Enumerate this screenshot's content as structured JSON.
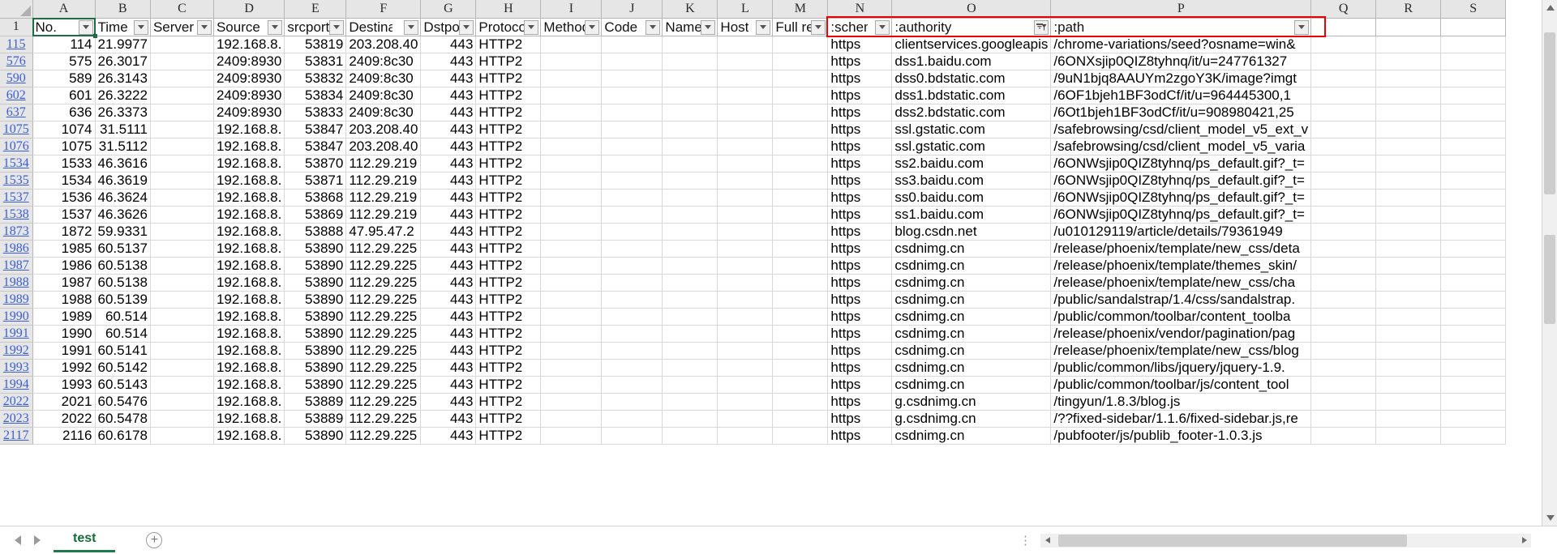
{
  "app": {
    "type": "spreadsheet",
    "sheet_tab": "test",
    "add_sheet_label": "+",
    "selected_cell": "A1",
    "accent_green": "#1f6b43",
    "annotation_color": "#ee0000",
    "row_header_color": "#3b5ed7"
  },
  "columns": {
    "letters": [
      "A",
      "B",
      "C",
      "D",
      "E",
      "F",
      "G",
      "H",
      "I",
      "J",
      "K",
      "L",
      "M",
      "N",
      "O",
      "P",
      "Q",
      "R",
      "S"
    ],
    "headers": [
      {
        "letter": "A",
        "label": "No.",
        "filter": "dropdown"
      },
      {
        "letter": "B",
        "label": "Time",
        "filter": "dropdown"
      },
      {
        "letter": "C",
        "label": "Server N",
        "filter": "dropdown"
      },
      {
        "letter": "D",
        "label": "Source",
        "filter": "dropdown"
      },
      {
        "letter": "E",
        "label": "srcport",
        "filter": "dropdown"
      },
      {
        "letter": "F",
        "label": "Destinat",
        "filter": "dropdown"
      },
      {
        "letter": "G",
        "label": "Dstport",
        "filter": "dropdown"
      },
      {
        "letter": "H",
        "label": "Protoco",
        "filter": "dropdown"
      },
      {
        "letter": "I",
        "label": "Method",
        "filter": "dropdown"
      },
      {
        "letter": "J",
        "label": "Code",
        "filter": "dropdown"
      },
      {
        "letter": "K",
        "label": "Name",
        "filter": "dropdown"
      },
      {
        "letter": "L",
        "label": "Host",
        "filter": "dropdown"
      },
      {
        "letter": "M",
        "label": "Full req",
        "filter": "dropdown"
      },
      {
        "letter": "N",
        "label": ":scheme",
        "filter": "dropdown"
      },
      {
        "letter": "O",
        "label": ":authority",
        "filter": "funnel"
      },
      {
        "letter": "P",
        "label": ":path",
        "filter": "dropdown"
      },
      {
        "letter": "Q",
        "label": "",
        "filter": "none"
      },
      {
        "letter": "R",
        "label": "",
        "filter": "none"
      },
      {
        "letter": "S",
        "label": "",
        "filter": "none"
      }
    ],
    "header_row_number": "1"
  },
  "rows": [
    {
      "rownum": "115",
      "no": "114",
      "time": "21.9977",
      "server": "",
      "source": "192.168.8.",
      "srcport": "53819",
      "destination": "203.208.40",
      "dstport": "443",
      "protocol": "HTTP2",
      "method": "",
      "code": "",
      "name": "",
      "host": "",
      "fullreq": "",
      "scheme": "https",
      "authority": "clientservices.googleapis",
      "path": "/chrome-variations/seed?osname=win&"
    },
    {
      "rownum": "576",
      "no": "575",
      "time": "26.3017",
      "server": "",
      "source": "2409:8930",
      "srcport": "53831",
      "destination": "2409:8c30",
      "dstport": "443",
      "protocol": "HTTP2",
      "method": "",
      "code": "",
      "name": "",
      "host": "",
      "fullreq": "",
      "scheme": "https",
      "authority": "dss1.baidu.com",
      "path": "/6ONXsjip0QIZ8tyhnq/it/u=247761327"
    },
    {
      "rownum": "590",
      "no": "589",
      "time": "26.3143",
      "server": "",
      "source": "2409:8930",
      "srcport": "53832",
      "destination": "2409:8c30",
      "dstport": "443",
      "protocol": "HTTP2",
      "method": "",
      "code": "",
      "name": "",
      "host": "",
      "fullreq": "",
      "scheme": "https",
      "authority": "dss0.bdstatic.com",
      "path": "/9uN1bjq8AAUYm2zgoY3K/image?imgt"
    },
    {
      "rownum": "602",
      "no": "601",
      "time": "26.3222",
      "server": "",
      "source": "2409:8930",
      "srcport": "53834",
      "destination": "2409:8c30",
      "dstport": "443",
      "protocol": "HTTP2",
      "method": "",
      "code": "",
      "name": "",
      "host": "",
      "fullreq": "",
      "scheme": "https",
      "authority": "dss1.bdstatic.com",
      "path": "/6OF1bjeh1BF3odCf/it/u=964445300,1"
    },
    {
      "rownum": "637",
      "no": "636",
      "time": "26.3373",
      "server": "",
      "source": "2409:8930",
      "srcport": "53833",
      "destination": "2409:8c30",
      "dstport": "443",
      "protocol": "HTTP2",
      "method": "",
      "code": "",
      "name": "",
      "host": "",
      "fullreq": "",
      "scheme": "https",
      "authority": "dss2.bdstatic.com",
      "path": "/6Ot1bjeh1BF3odCf/it/u=908980421,25"
    },
    {
      "rownum": "1075",
      "no": "1074",
      "time": "31.5111",
      "server": "",
      "source": "192.168.8.",
      "srcport": "53847",
      "destination": "203.208.40",
      "dstport": "443",
      "protocol": "HTTP2",
      "method": "",
      "code": "",
      "name": "",
      "host": "",
      "fullreq": "",
      "scheme": "https",
      "authority": "ssl.gstatic.com",
      "path": "/safebrowsing/csd/client_model_v5_ext_v"
    },
    {
      "rownum": "1076",
      "no": "1075",
      "time": "31.5112",
      "server": "",
      "source": "192.168.8.",
      "srcport": "53847",
      "destination": "203.208.40",
      "dstport": "443",
      "protocol": "HTTP2",
      "method": "",
      "code": "",
      "name": "",
      "host": "",
      "fullreq": "",
      "scheme": "https",
      "authority": "ssl.gstatic.com",
      "path": "/safebrowsing/csd/client_model_v5_varia"
    },
    {
      "rownum": "1534",
      "no": "1533",
      "time": "46.3616",
      "server": "",
      "source": "192.168.8.",
      "srcport": "53870",
      "destination": "112.29.219",
      "dstport": "443",
      "protocol": "HTTP2",
      "method": "",
      "code": "",
      "name": "",
      "host": "",
      "fullreq": "",
      "scheme": "https",
      "authority": "ss2.baidu.com",
      "path": "/6ONWsjip0QIZ8tyhnq/ps_default.gif?_t="
    },
    {
      "rownum": "1535",
      "no": "1534",
      "time": "46.3619",
      "server": "",
      "source": "192.168.8.",
      "srcport": "53871",
      "destination": "112.29.219",
      "dstport": "443",
      "protocol": "HTTP2",
      "method": "",
      "code": "",
      "name": "",
      "host": "",
      "fullreq": "",
      "scheme": "https",
      "authority": "ss3.baidu.com",
      "path": "/6ONWsjip0QIZ8tyhnq/ps_default.gif?_t="
    },
    {
      "rownum": "1537",
      "no": "1536",
      "time": "46.3624",
      "server": "",
      "source": "192.168.8.",
      "srcport": "53868",
      "destination": "112.29.219",
      "dstport": "443",
      "protocol": "HTTP2",
      "method": "",
      "code": "",
      "name": "",
      "host": "",
      "fullreq": "",
      "scheme": "https",
      "authority": "ss0.baidu.com",
      "path": "/6ONWsjip0QIZ8tyhnq/ps_default.gif?_t="
    },
    {
      "rownum": "1538",
      "no": "1537",
      "time": "46.3626",
      "server": "",
      "source": "192.168.8.",
      "srcport": "53869",
      "destination": "112.29.219",
      "dstport": "443",
      "protocol": "HTTP2",
      "method": "",
      "code": "",
      "name": "",
      "host": "",
      "fullreq": "",
      "scheme": "https",
      "authority": "ss1.baidu.com",
      "path": "/6ONWsjip0QIZ8tyhnq/ps_default.gif?_t="
    },
    {
      "rownum": "1873",
      "no": "1872",
      "time": "59.9331",
      "server": "",
      "source": "192.168.8.",
      "srcport": "53888",
      "destination": "47.95.47.2",
      "dstport": "443",
      "protocol": "HTTP2",
      "method": "",
      "code": "",
      "name": "",
      "host": "",
      "fullreq": "",
      "scheme": "https",
      "authority": "blog.csdn.net",
      "path": "/u010129119/article/details/79361949"
    },
    {
      "rownum": "1986",
      "no": "1985",
      "time": "60.5137",
      "server": "",
      "source": "192.168.8.",
      "srcport": "53890",
      "destination": "112.29.225",
      "dstport": "443",
      "protocol": "HTTP2",
      "method": "",
      "code": "",
      "name": "",
      "host": "",
      "fullreq": "",
      "scheme": "https",
      "authority": "csdnimg.cn",
      "path": "/release/phoenix/template/new_css/deta"
    },
    {
      "rownum": "1987",
      "no": "1986",
      "time": "60.5138",
      "server": "",
      "source": "192.168.8.",
      "srcport": "53890",
      "destination": "112.29.225",
      "dstport": "443",
      "protocol": "HTTP2",
      "method": "",
      "code": "",
      "name": "",
      "host": "",
      "fullreq": "",
      "scheme": "https",
      "authority": "csdnimg.cn",
      "path": "/release/phoenix/template/themes_skin/"
    },
    {
      "rownum": "1988",
      "no": "1987",
      "time": "60.5138",
      "server": "",
      "source": "192.168.8.",
      "srcport": "53890",
      "destination": "112.29.225",
      "dstport": "443",
      "protocol": "HTTP2",
      "method": "",
      "code": "",
      "name": "",
      "host": "",
      "fullreq": "",
      "scheme": "https",
      "authority": "csdnimg.cn",
      "path": "/release/phoenix/template/new_css/cha"
    },
    {
      "rownum": "1989",
      "no": "1988",
      "time": "60.5139",
      "server": "",
      "source": "192.168.8.",
      "srcport": "53890",
      "destination": "112.29.225",
      "dstport": "443",
      "protocol": "HTTP2",
      "method": "",
      "code": "",
      "name": "",
      "host": "",
      "fullreq": "",
      "scheme": "https",
      "authority": "csdnimg.cn",
      "path": "/public/sandalstrap/1.4/css/sandalstrap."
    },
    {
      "rownum": "1990",
      "no": "1989",
      "time": "60.514",
      "server": "",
      "source": "192.168.8.",
      "srcport": "53890",
      "destination": "112.29.225",
      "dstport": "443",
      "protocol": "HTTP2",
      "method": "",
      "code": "",
      "name": "",
      "host": "",
      "fullreq": "",
      "scheme": "https",
      "authority": "csdnimg.cn",
      "path": "/public/common/toolbar/content_toolba"
    },
    {
      "rownum": "1991",
      "no": "1990",
      "time": "60.514",
      "server": "",
      "source": "192.168.8.",
      "srcport": "53890",
      "destination": "112.29.225",
      "dstport": "443",
      "protocol": "HTTP2",
      "method": "",
      "code": "",
      "name": "",
      "host": "",
      "fullreq": "",
      "scheme": "https",
      "authority": "csdnimg.cn",
      "path": "/release/phoenix/vendor/pagination/pag"
    },
    {
      "rownum": "1992",
      "no": "1991",
      "time": "60.5141",
      "server": "",
      "source": "192.168.8.",
      "srcport": "53890",
      "destination": "112.29.225",
      "dstport": "443",
      "protocol": "HTTP2",
      "method": "",
      "code": "",
      "name": "",
      "host": "",
      "fullreq": "",
      "scheme": "https",
      "authority": "csdnimg.cn",
      "path": "/release/phoenix/template/new_css/blog"
    },
    {
      "rownum": "1993",
      "no": "1992",
      "time": "60.5142",
      "server": "",
      "source": "192.168.8.",
      "srcport": "53890",
      "destination": "112.29.225",
      "dstport": "443",
      "protocol": "HTTP2",
      "method": "",
      "code": "",
      "name": "",
      "host": "",
      "fullreq": "",
      "scheme": "https",
      "authority": "csdnimg.cn",
      "path": "/public/common/libs/jquery/jquery-1.9."
    },
    {
      "rownum": "1994",
      "no": "1993",
      "time": "60.5143",
      "server": "",
      "source": "192.168.8.",
      "srcport": "53890",
      "destination": "112.29.225",
      "dstport": "443",
      "protocol": "HTTP2",
      "method": "",
      "code": "",
      "name": "",
      "host": "",
      "fullreq": "",
      "scheme": "https",
      "authority": "csdnimg.cn",
      "path": "/public/common/toolbar/js/content_tool"
    },
    {
      "rownum": "2022",
      "no": "2021",
      "time": "60.5476",
      "server": "",
      "source": "192.168.8.",
      "srcport": "53889",
      "destination": "112.29.225",
      "dstport": "443",
      "protocol": "HTTP2",
      "method": "",
      "code": "",
      "name": "",
      "host": "",
      "fullreq": "",
      "scheme": "https",
      "authority": "g.csdnimg.cn",
      "path": "/tingyun/1.8.3/blog.js"
    },
    {
      "rownum": "2023",
      "no": "2022",
      "time": "60.5478",
      "server": "",
      "source": "192.168.8.",
      "srcport": "53889",
      "destination": "112.29.225",
      "dstport": "443",
      "protocol": "HTTP2",
      "method": "",
      "code": "",
      "name": "",
      "host": "",
      "fullreq": "",
      "scheme": "https",
      "authority": "g.csdnimg.cn",
      "path": "/??fixed-sidebar/1.1.6/fixed-sidebar.js,re"
    },
    {
      "rownum": "2117",
      "no": "2116",
      "time": "60.6178",
      "server": "",
      "source": "192.168.8.",
      "srcport": "53890",
      "destination": "112.29.225",
      "dstport": "443",
      "protocol": "HTTP2",
      "method": "",
      "code": "",
      "name": "",
      "host": "",
      "fullreq": "",
      "scheme": "https",
      "authority": "csdnimg.cn",
      "path": "/pubfooter/js/publib_footer-1.0.3.js"
    }
  ],
  "annotation": {
    "label": "red-highlight-rectangle",
    "covers_columns": [
      ":scheme",
      ":authority",
      ":path"
    ]
  },
  "scrollbars": {
    "vertical_present": true,
    "horizontal_present": true
  }
}
